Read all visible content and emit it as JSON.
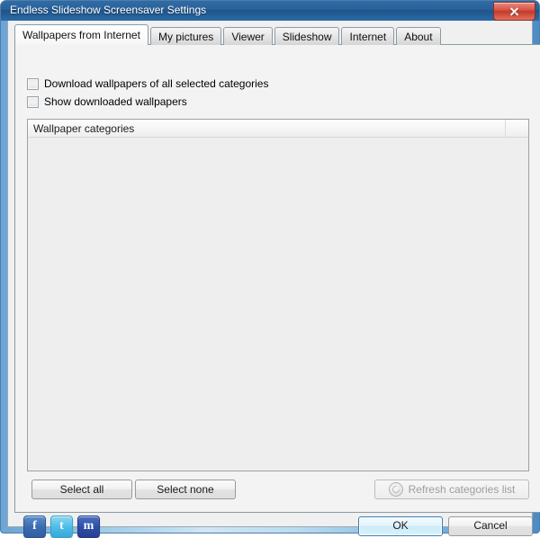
{
  "window": {
    "title": "Endless Slideshow Screensaver Settings",
    "close_label": "x",
    "close_icon": "close-icon"
  },
  "tabs": [
    {
      "label": "Wallpapers from Internet",
      "active": true
    },
    {
      "label": "My pictures",
      "active": false
    },
    {
      "label": "Viewer",
      "active": false
    },
    {
      "label": "Slideshow",
      "active": false
    },
    {
      "label": "Internet",
      "active": false
    },
    {
      "label": "About",
      "active": false
    }
  ],
  "options": {
    "download_all": {
      "label": "Download wallpapers of all selected categories",
      "checked": false
    },
    "show_downloaded": {
      "label": "Show downloaded wallpapers",
      "checked": false
    }
  },
  "list": {
    "column_header": "Wallpaper categories",
    "filler_header": "",
    "rows": []
  },
  "actions": {
    "select_all": "Select all",
    "select_none": "Select none",
    "refresh": "Refresh categories list",
    "refresh_icon": "refresh-icon",
    "refresh_disabled": true
  },
  "social": {
    "facebook": "f",
    "twitter": "t",
    "myspace": "m"
  },
  "dialog": {
    "ok": "OK",
    "cancel": "Cancel"
  },
  "colors": {
    "frame": "#6ba4d6",
    "titlebar": "#2a6099",
    "close": "#c33a2b",
    "default_button_border": "#3c7fb1",
    "panel": "#f3f3f3",
    "list_background": "#eeeeee"
  }
}
